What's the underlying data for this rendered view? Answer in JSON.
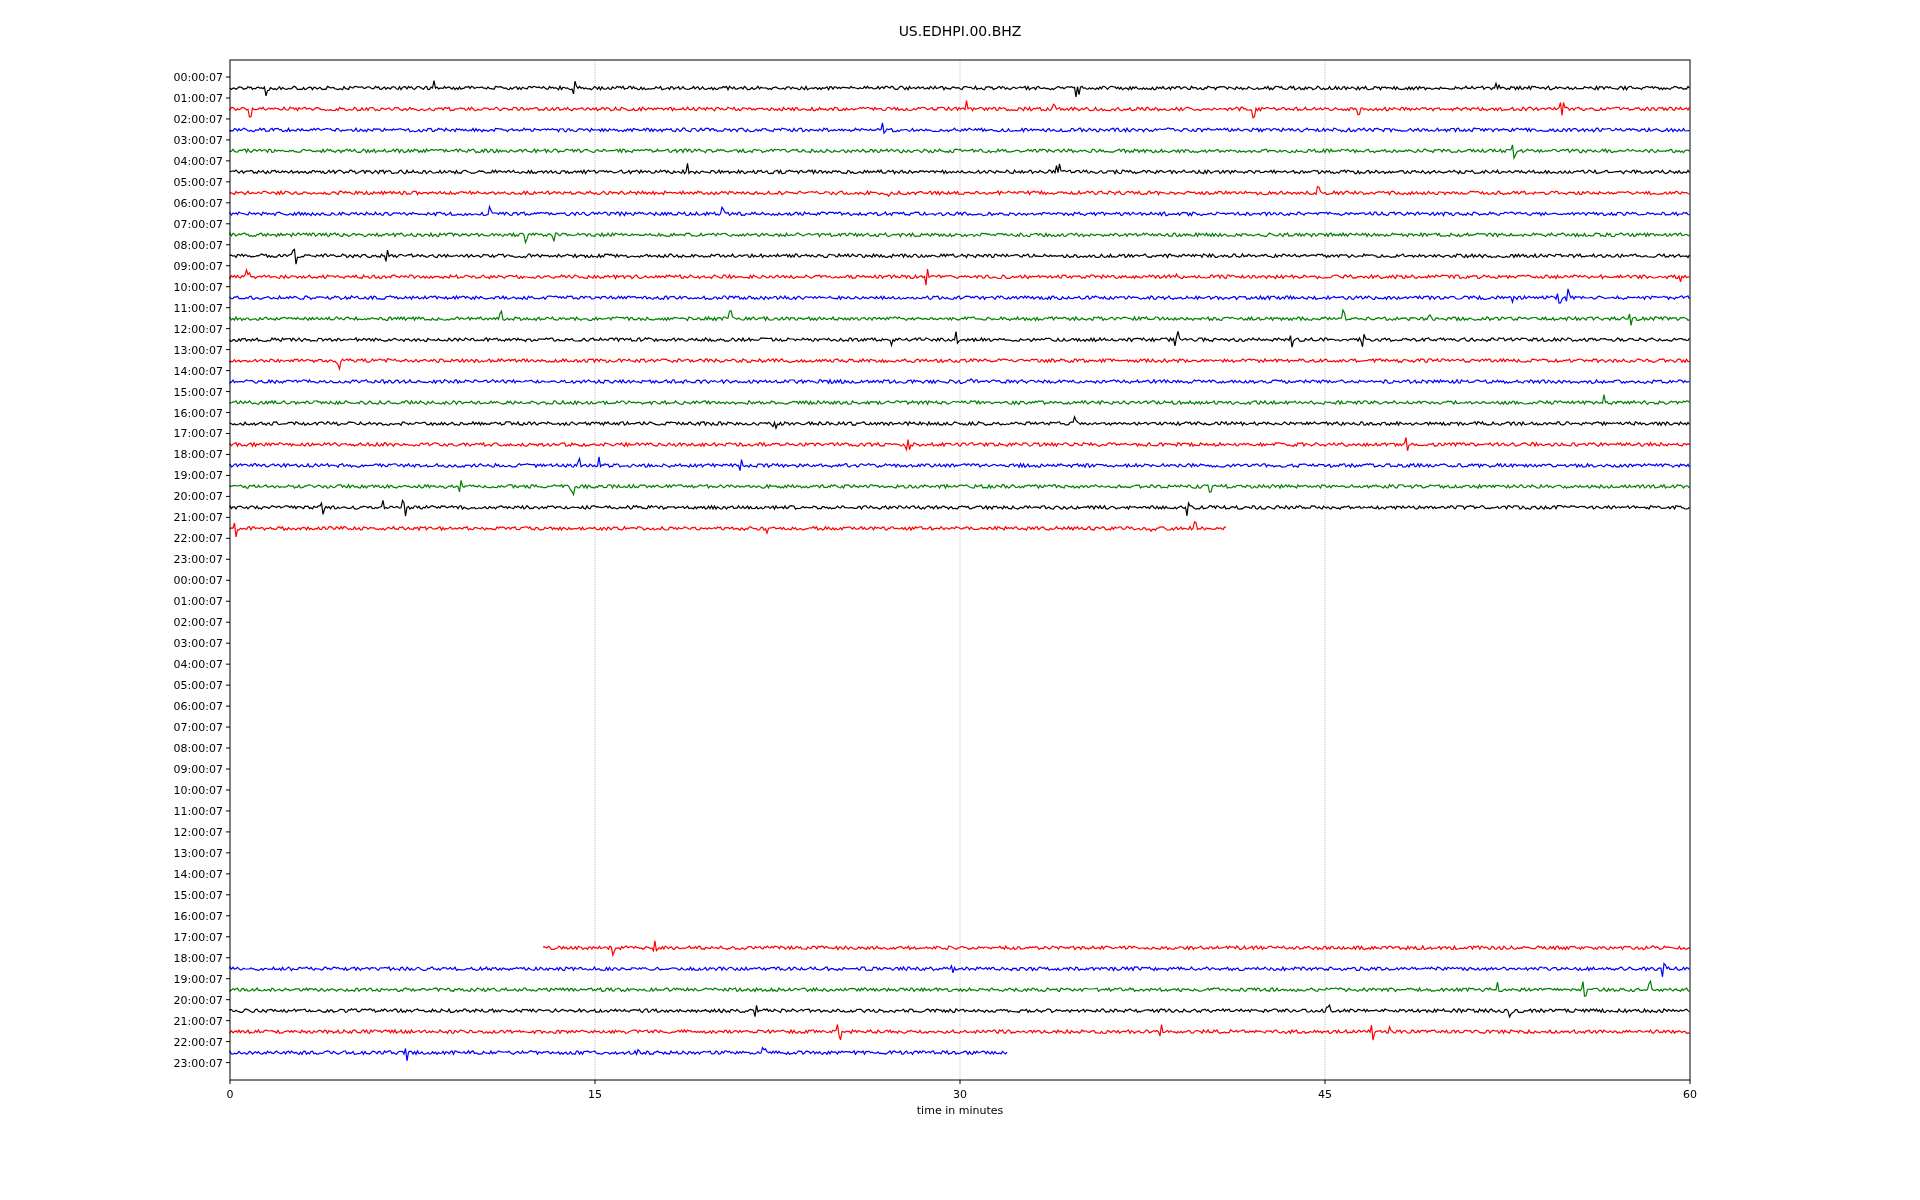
{
  "title": "US.EDHPI.00.BHZ",
  "x_axis": {
    "label": "time in minutes",
    "ticks": [
      "0",
      "15",
      "30",
      "45",
      "60"
    ]
  },
  "rows": [
    {
      "label": "00:00:07",
      "trace": {
        "kind": "full",
        "color": "#000000"
      }
    },
    {
      "label": "01:00:07",
      "trace": {
        "kind": "full",
        "color": "#ff0000"
      }
    },
    {
      "label": "02:00:07",
      "trace": {
        "kind": "full",
        "color": "#0000ff"
      }
    },
    {
      "label": "03:00:07",
      "trace": {
        "kind": "full",
        "color": "#008000"
      }
    },
    {
      "label": "04:00:07",
      "trace": {
        "kind": "full",
        "color": "#000000"
      }
    },
    {
      "label": "05:00:07",
      "trace": {
        "kind": "full",
        "color": "#ff0000"
      }
    },
    {
      "label": "06:00:07",
      "trace": {
        "kind": "full",
        "color": "#0000ff"
      }
    },
    {
      "label": "07:00:07",
      "trace": {
        "kind": "full",
        "color": "#008000"
      }
    },
    {
      "label": "08:00:07",
      "trace": {
        "kind": "full",
        "color": "#000000"
      }
    },
    {
      "label": "09:00:07",
      "trace": {
        "kind": "full",
        "color": "#ff0000"
      }
    },
    {
      "label": "10:00:07",
      "trace": {
        "kind": "full",
        "color": "#0000ff"
      }
    },
    {
      "label": "11:00:07",
      "trace": {
        "kind": "full",
        "color": "#008000"
      }
    },
    {
      "label": "12:00:07",
      "trace": {
        "kind": "full",
        "color": "#000000"
      }
    },
    {
      "label": "13:00:07",
      "trace": {
        "kind": "full",
        "color": "#ff0000"
      }
    },
    {
      "label": "14:00:07",
      "trace": {
        "kind": "full",
        "color": "#0000ff"
      }
    },
    {
      "label": "15:00:07",
      "trace": {
        "kind": "full",
        "color": "#008000"
      }
    },
    {
      "label": "16:00:07",
      "trace": {
        "kind": "full",
        "color": "#000000"
      }
    },
    {
      "label": "17:00:07",
      "trace": {
        "kind": "full",
        "color": "#ff0000"
      }
    },
    {
      "label": "18:00:07",
      "trace": {
        "kind": "full",
        "color": "#0000ff"
      }
    },
    {
      "label": "19:00:07",
      "trace": {
        "kind": "full",
        "color": "#008000"
      }
    },
    {
      "label": "20:00:07",
      "trace": {
        "kind": "full",
        "color": "#000000"
      }
    },
    {
      "label": "21:00:07",
      "trace": {
        "kind": "ends-early",
        "color": "#ff0000",
        "level": 0.683
      }
    },
    {
      "label": "22:00:07"
    },
    {
      "label": "23:00:07"
    },
    {
      "label": "00:00:07"
    },
    {
      "label": "01:00:07"
    },
    {
      "label": "02:00:07"
    },
    {
      "label": "03:00:07"
    },
    {
      "label": "04:00:07"
    },
    {
      "label": "05:00:07"
    },
    {
      "label": "06:00:07"
    },
    {
      "label": "07:00:07"
    },
    {
      "label": "08:00:07"
    },
    {
      "label": "09:00:07"
    },
    {
      "label": "10:00:07"
    },
    {
      "label": "11:00:07"
    },
    {
      "label": "12:00:07"
    },
    {
      "label": "13:00:07"
    },
    {
      "label": "14:00:07"
    },
    {
      "label": "15:00:07"
    },
    {
      "label": "16:00:07"
    },
    {
      "label": "17:00:07",
      "trace": {
        "kind": "starts-late",
        "color": "#ff0000",
        "level": 0.785
      }
    },
    {
      "label": "18:00:07",
      "trace": {
        "kind": "full",
        "color": "#0000ff"
      }
    },
    {
      "label": "19:00:07",
      "trace": {
        "kind": "full",
        "color": "#008000"
      }
    },
    {
      "label": "20:00:07",
      "trace": {
        "kind": "full",
        "color": "#000000"
      }
    },
    {
      "label": "21:00:07",
      "trace": {
        "kind": "full",
        "color": "#ff0000"
      }
    },
    {
      "label": "22:00:07",
      "trace": {
        "kind": "ends-early",
        "color": "#0000ff",
        "level": 0.533
      }
    },
    {
      "label": "23:00:07"
    }
  ]
}
